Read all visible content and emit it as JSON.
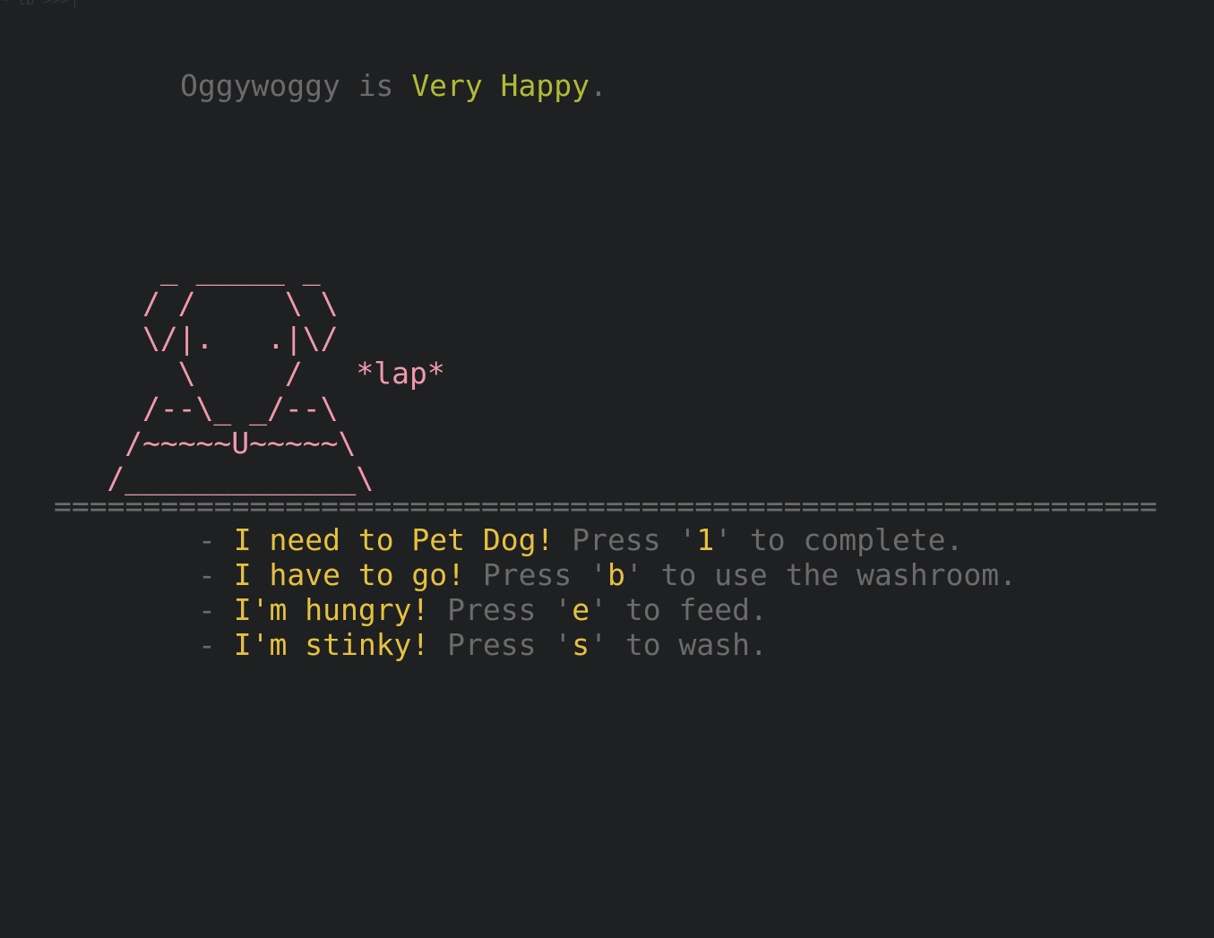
{
  "prompt": "~ lb >>>",
  "status": {
    "pet_name": "Oggywoggy",
    "verb": "is",
    "mood": "Very Happy",
    "end": "."
  },
  "art": {
    "lines": [
      "         _ _____ _",
      "        / /     \\ \\",
      "        \\/|.   .|\\/",
      "          \\     /   *lap*",
      "        /--\\_ _/--\\",
      "       /~~~~~U~~~~~\\",
      "      /_____________\\"
    ],
    "color": "#f299aa"
  },
  "divider": "==============================================================",
  "tasks": [
    {
      "bullet": "- ",
      "need": "I need to Pet Dog!",
      "pre": " Press '",
      "key": "1",
      "post": "' to complete."
    },
    {
      "bullet": "- ",
      "need": "I have to go!",
      "pre": " Press '",
      "key": "b",
      "post": "' to use the washroom."
    },
    {
      "bullet": "- ",
      "need": "I'm hungry!",
      "pre": " Press '",
      "key": "e",
      "post": "' to feed."
    },
    {
      "bullet": "- ",
      "need": "I'm stinky!",
      "pre": " Press '",
      "key": "s",
      "post": "' to wash."
    }
  ],
  "colors": {
    "background": "#1f2022",
    "dim_text": "#6b6b6b",
    "mood": "#b1bb35",
    "need": "#e6c13f",
    "art": "#f299aa"
  }
}
